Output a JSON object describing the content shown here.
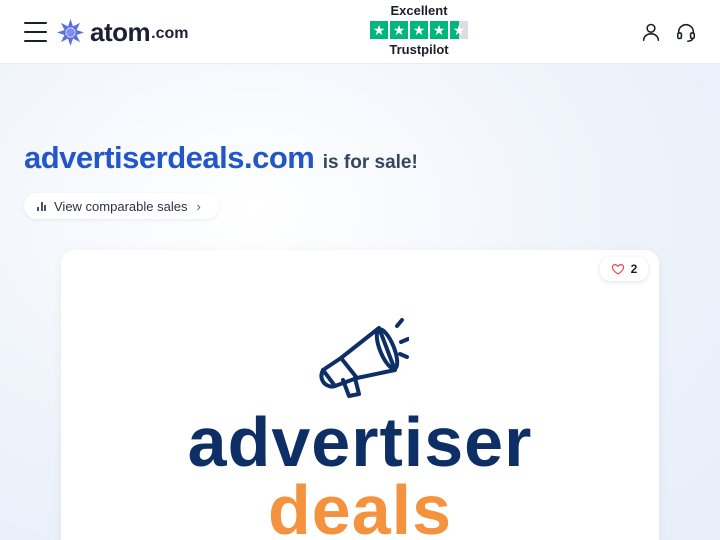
{
  "header": {
    "logo_word": "atom",
    "logo_tld": ".com",
    "trustpilot": {
      "rating_label": "Excellent",
      "brand": "Trustpilot",
      "stars": 4.5
    },
    "icons": [
      "menu-icon",
      "atom-logo-icon",
      "user-icon",
      "headset-icon"
    ]
  },
  "hero": {
    "domain": "advertiserdeals.com",
    "suffix": "is for sale!",
    "compare_label": "View comparable sales",
    "compare_chevron": "›"
  },
  "card": {
    "likes": "2",
    "logo_line1": "advertiser",
    "logo_line2": "deals"
  },
  "colors": {
    "accent": "#2356c8",
    "trustpilot_green": "#00b67a",
    "brand_navy": "#0e2f66",
    "brand_orange": "#f5923e",
    "heart": "#e5484d"
  }
}
